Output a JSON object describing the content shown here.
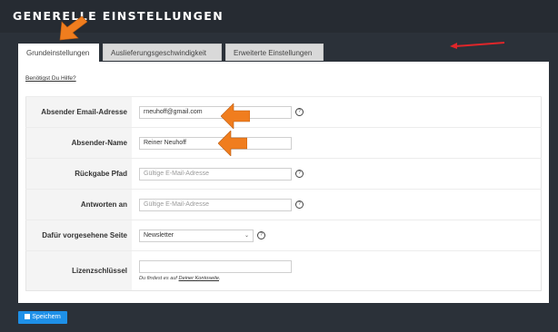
{
  "header": {
    "title": "GENERELLE EINSTELLUNGEN"
  },
  "tabs": [
    {
      "label": "Grundeinstellungen",
      "active": true
    },
    {
      "label": "Auslieferungsgeschwindigkeit",
      "active": false
    },
    {
      "label": "Erweiterte Einstellungen",
      "active": false
    }
  ],
  "help": {
    "label": "Benötigst Du Hilfe?"
  },
  "form": {
    "sender_email": {
      "label": "Absender Email-Adresse",
      "value": "rneuhoff@gmail.com"
    },
    "sender_name": {
      "label": "Absender-Name",
      "value": "Reiner Neuhoff"
    },
    "return_path": {
      "label": "Rückgabe Pfad",
      "placeholder": "Gültige E-Mail-Adresse"
    },
    "reply_to": {
      "label": "Antworten an",
      "placeholder": "Gültige E-Mail-Adresse"
    },
    "page": {
      "label": "Dafür vorgesehene Seite",
      "selected": "Newsletter"
    },
    "license": {
      "label": "Lizenzschlüssel",
      "value": "",
      "note_prefix": "Du findest es auf ",
      "note_link": "Deiner Kontoseite",
      "note_suffix": "."
    }
  },
  "save_button": {
    "label": "Speichern"
  },
  "help_icon_glyph": "?",
  "colors": {
    "background": "#2b3139",
    "header": "#262b32",
    "panel": "#ffffff",
    "save_button": "#1e90e8",
    "annotation_arrow": "#f07d1e",
    "annotation_line": "#e0262a"
  }
}
